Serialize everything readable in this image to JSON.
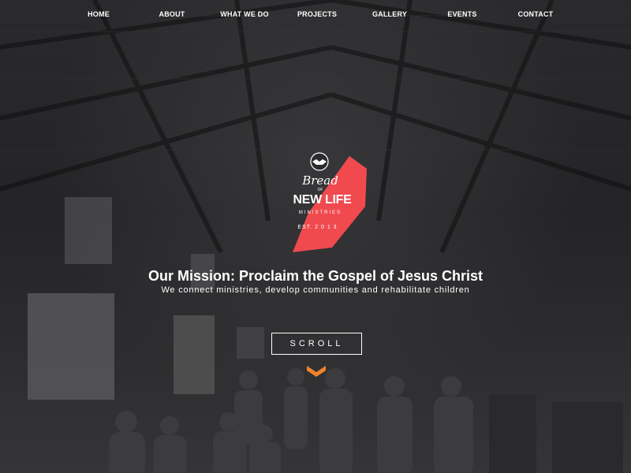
{
  "nav": {
    "items": [
      {
        "label": "HOME"
      },
      {
        "label": "ABOUT"
      },
      {
        "label": "WHAT WE DO"
      },
      {
        "label": "PROJECTS"
      },
      {
        "label": "GALLERY"
      },
      {
        "label": "EVENTS"
      },
      {
        "label": "CONTACT"
      }
    ]
  },
  "logo": {
    "line1": "Bread",
    "line2": "OF",
    "line3": "NEW LIFE",
    "line4": "MINISTRIES",
    "est": "EST. 2 0 1 3",
    "icon": "handshake-icon",
    "accent_color": "#f04a4f"
  },
  "hero": {
    "title": "Our Mission: Proclaim the Gospel of Jesus Christ",
    "subtitle": "We connect ministries, develop communities and rehabilitate children",
    "scroll_label": "SCROLL",
    "chevron_icon": "chevron-down-icon",
    "chevron_color": "#f0822a"
  }
}
